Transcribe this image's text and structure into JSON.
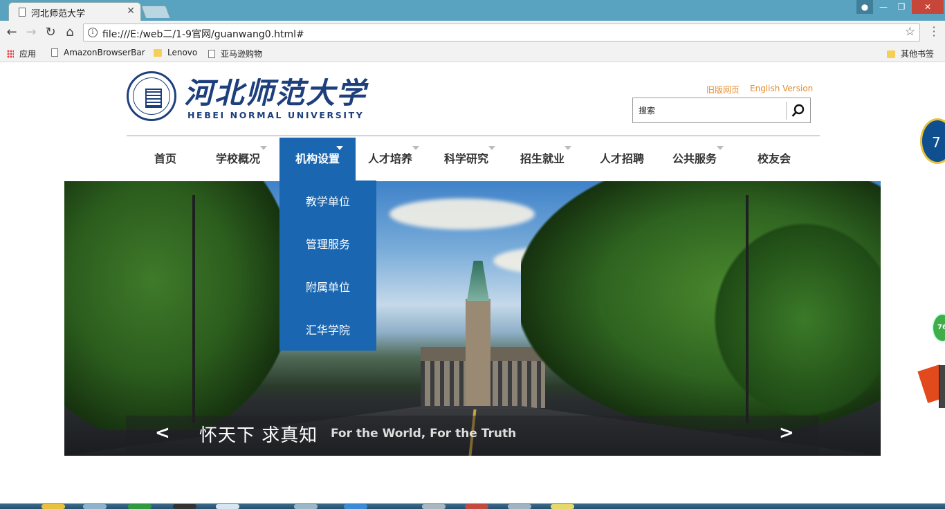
{
  "browser": {
    "tab_title": "河北师范大学",
    "url": "file:///E:/web二/1-9官网/guanwang0.html#",
    "bookmarks": [
      {
        "label": "应用",
        "icon": "apps-icon"
      },
      {
        "label": "AmazonBrowserBar",
        "icon": "page-icon"
      },
      {
        "label": "Lenovo",
        "icon": "folder-icon"
      },
      {
        "label": "亚马逊购物",
        "icon": "page-icon"
      }
    ],
    "other_bookmarks": "其他书签"
  },
  "header": {
    "logo_cn": "河北师范大学",
    "logo_en": "HEBEI NORMAL UNIVERSITY",
    "links": [
      "旧版网页",
      "English Version"
    ],
    "search_placeholder": "搜索"
  },
  "nav": {
    "items": [
      {
        "label": "首页",
        "has_dropdown": false
      },
      {
        "label": "学校概况",
        "has_dropdown": true
      },
      {
        "label": "机构设置",
        "has_dropdown": true,
        "active": true
      },
      {
        "label": "人才培养",
        "has_dropdown": true
      },
      {
        "label": "科学研究",
        "has_dropdown": true
      },
      {
        "label": "招生就业",
        "has_dropdown": true
      },
      {
        "label": "人才招聘",
        "has_dropdown": false
      },
      {
        "label": "公共服务",
        "has_dropdown": true
      },
      {
        "label": "校友会",
        "has_dropdown": false
      }
    ],
    "dropdown": [
      "教学单位",
      "管理服务",
      "附属单位",
      "汇华学院"
    ]
  },
  "hero": {
    "prev": "<",
    "next": ">",
    "slogan_cn": "怀天下  求真知",
    "slogan_en": "For the World, For the Truth"
  },
  "floating": {
    "badge_a": "7",
    "badge_b": "76"
  },
  "colors": {
    "nav_active": "#1a66b0",
    "top_link": "#e28a2a",
    "logo_blue": "#1d3f7c"
  }
}
